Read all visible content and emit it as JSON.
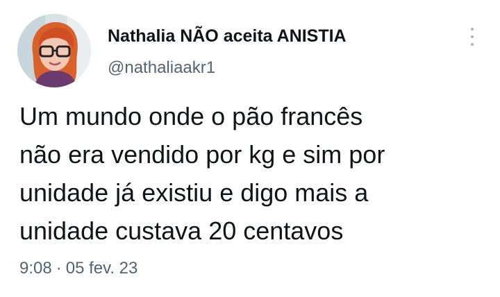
{
  "tweet": {
    "author": {
      "display_name": "Nathalia NÃO aceita ANISTIA",
      "handle": "@nathaliaakr1",
      "avatar_icon": "profile-photo"
    },
    "text_lines": [
      "Um mundo onde o pão francês",
      "não era vendido por kg e sim por",
      "unidade já existiu e digo mais a",
      "unidade custava 20 centavos"
    ],
    "time": "9:08",
    "separator": "·",
    "date": "05 fev. 23",
    "more_icon": "more-options-icon"
  },
  "colors": {
    "primary_text": "#0f1419",
    "secondary_text": "#536471",
    "background": "#ffffff"
  }
}
